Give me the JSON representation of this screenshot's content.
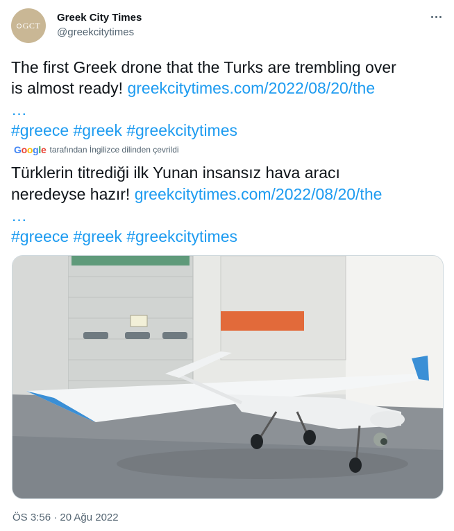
{
  "author": {
    "display_name": "Greek City Times",
    "handle": "@greekcitytimes",
    "avatar_text": "GCT"
  },
  "tweet": {
    "text_line1": "The first Greek drone that the Turks are trembling over",
    "text_line2_plain": "is almost ready! ",
    "text_line2_link": "greekcitytimes.com/2022/08/20/the",
    "ellipsis": "…",
    "hashtags": "#greece #greek #greekcitytimes"
  },
  "translation": {
    "provider": "Google",
    "note": "tarafından İngilizce dilinden çevrildi",
    "text_line1": "Türklerin titrediği ilk Yunan insansız hava aracı",
    "text_line2_plain": "neredeyse hazır! ",
    "text_line2_link": "greekcitytimes.com/2022/08/20/the",
    "ellipsis": "…",
    "hashtags": "#greece #greek #greekcitytimes"
  },
  "timestamp": "ÖS 3:56 · 20 Ağu 2022",
  "colors": {
    "link": "#1d9bf0",
    "text": "#0f1419",
    "muted": "#536471",
    "wing_tip": "#3a8fd6"
  }
}
